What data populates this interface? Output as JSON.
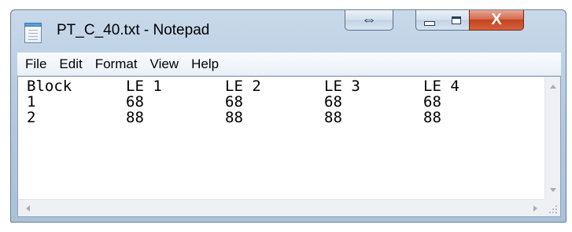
{
  "window": {
    "title": "PT_C_40.txt - Notepad"
  },
  "caption_buttons": {
    "resize_glyph": "⇔",
    "close_glyph": "X"
  },
  "menu": {
    "items": [
      "File",
      "Edit",
      "Format",
      "View",
      "Help"
    ]
  },
  "document": {
    "header": [
      "Block",
      "LE 1",
      "LE 2",
      "LE 3",
      "LE 4"
    ],
    "rows": [
      [
        "1",
        "68",
        "68",
        "68",
        "68"
      ],
      [
        "2",
        "88",
        "88",
        "88",
        "88"
      ]
    ]
  },
  "icons": {
    "app": "notepad-document-icon",
    "resize": "resize-arrows-icon",
    "minimize": "minimize-icon",
    "maximize": "maximize-icon",
    "close": "close-icon"
  },
  "colors": {
    "titlebar": "#b5cae0",
    "close_button": "#c2441f",
    "menubar": "#f0f4f9"
  }
}
